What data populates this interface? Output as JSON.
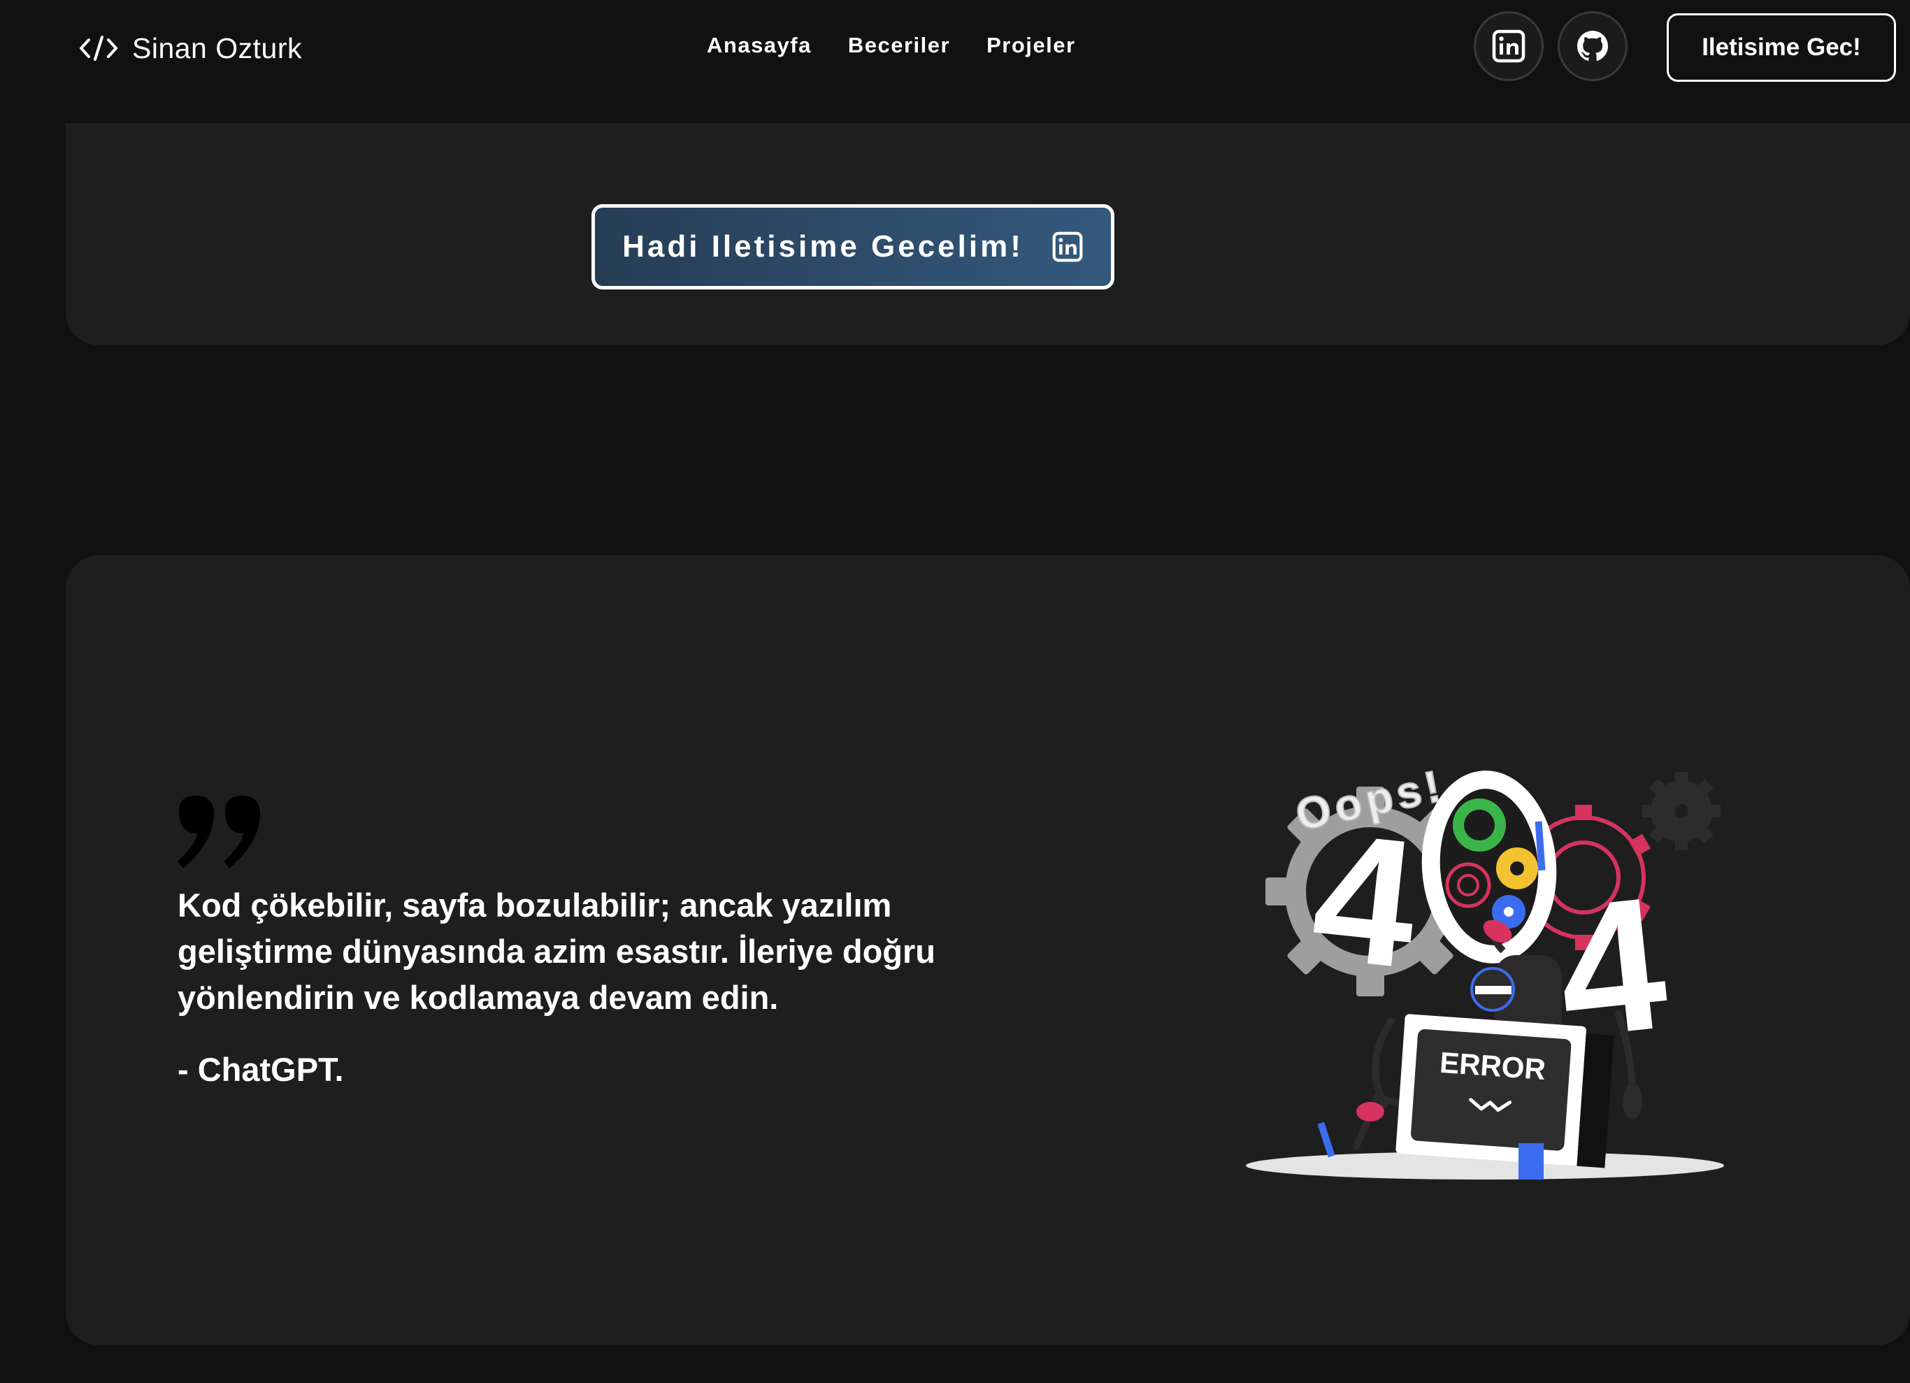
{
  "navbar": {
    "brand": {
      "icon": "code-brackets-icon",
      "name": "Sinan Ozturk"
    },
    "links": [
      "Anasayfa",
      "Beceriler",
      "Projeler"
    ],
    "social": [
      {
        "icon": "linkedin-icon"
      },
      {
        "icon": "github-icon"
      }
    ],
    "contact_label": "Iletisime Gec!"
  },
  "top_card": {
    "cta_label": "Hadi Iletisime Gecelim!",
    "cta_icon": "linkedin-icon"
  },
  "quote": {
    "text": "Kod çökebilir, sayfa bozulabilir; ancak yazılım geliştirme dünyasında azim esastır. İleriye doğru yönlendirin ve kodlamaya devam edin.",
    "author": "- ChatGPT."
  },
  "illustration": {
    "title": "Oops!",
    "digits": [
      "4",
      "4"
    ],
    "screen_text": "ERROR"
  },
  "colors": {
    "background": "#111111",
    "card": "#1e1e1e",
    "cta_gradient_start": "#263d55",
    "cta_gradient_end": "#34597d"
  }
}
